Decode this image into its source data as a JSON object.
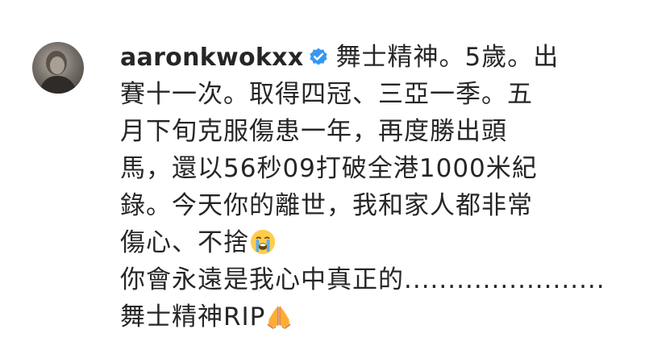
{
  "comment": {
    "username": "aaronkwokxx",
    "lines": [
      "舞士精神。5歲。出",
      "賽十一次。取得四冠、三亞一季。五",
      "月下旬克服傷患一年，再度勝出頭",
      "馬，還以56秒09打破全港1000米紀",
      "錄。今天你的離世，我和家人都非常",
      "傷心、不捨",
      "你會永遠是我心中真正的.......................",
      "舞士精神RIP"
    ],
    "icons": {
      "avatar": "profile-avatar",
      "badge": "verified-badge-icon",
      "cry": "loudly-crying-face-emoji",
      "pray": "folded-hands-emoji"
    },
    "colors": {
      "verified": "#3897f0",
      "text": "#262626"
    }
  }
}
